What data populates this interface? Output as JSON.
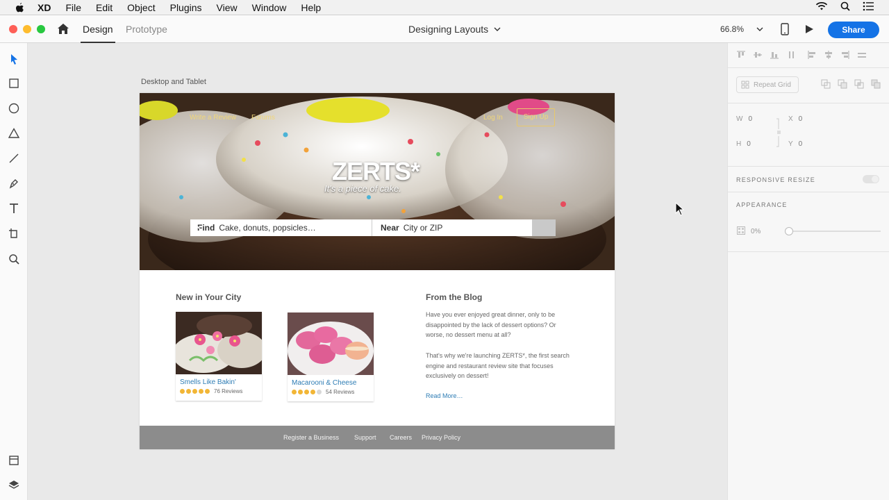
{
  "menubar": {
    "items": [
      "XD",
      "File",
      "Edit",
      "Object",
      "Plugins",
      "View",
      "Window",
      "Help"
    ]
  },
  "titlebar": {
    "tabs": [
      "Design",
      "Prototype"
    ],
    "document_title": "Designing Layouts",
    "zoom": "66.8%",
    "share_label": "Share"
  },
  "panel": {
    "repeat_grid": "Repeat Grid",
    "w_label": "W",
    "w_value": "0",
    "h_label": "H",
    "h_value": "0",
    "x_label": "X",
    "x_value": "0",
    "y_label": "Y",
    "y_value": "0",
    "responsive_resize": "RESPONSIVE RESIZE",
    "appearance": "APPEARANCE",
    "opacity": "0%"
  },
  "canvas": {
    "artboard_label": "Desktop and Tablet"
  },
  "site": {
    "nav": {
      "write_review": "Write a Review",
      "forums": "Forums",
      "login": "Log In",
      "signup": "Sign Up"
    },
    "logo": "ZERTS*",
    "tagline": "It's a piece of cake.",
    "search": {
      "find_label": "Find",
      "find_placeholder": "Cake, donuts, popsicles…",
      "near_label": "Near",
      "near_placeholder": "City or ZIP"
    },
    "new_in_city": {
      "heading": "New in Your City",
      "cards": [
        {
          "name": "Smells Like Bakin'",
          "reviews": "76 Reviews",
          "stars": 5
        },
        {
          "name": "Macarooni & Cheese",
          "reviews": "54 Reviews",
          "stars": 4
        }
      ]
    },
    "blog": {
      "heading": "From the Blog",
      "para1": "Have you ever enjoyed great dinner, only to be disappointed by the lack of dessert options? Or worse, no dessert menu at all?",
      "para2": "That's why we're launching ZERTS*, the first search engine and restaurant review site that focuses exclusively on dessert!",
      "read_more": "Read More…"
    },
    "footer": [
      "Register a Business",
      "Support",
      "Careers",
      "Privacy Policy"
    ]
  },
  "colors": {
    "accent": "#1473e6",
    "link": "#2d7cb4",
    "star": "#f2b636",
    "nav_gold": "#f1d779",
    "footer_bg": "#8c8c8c"
  }
}
